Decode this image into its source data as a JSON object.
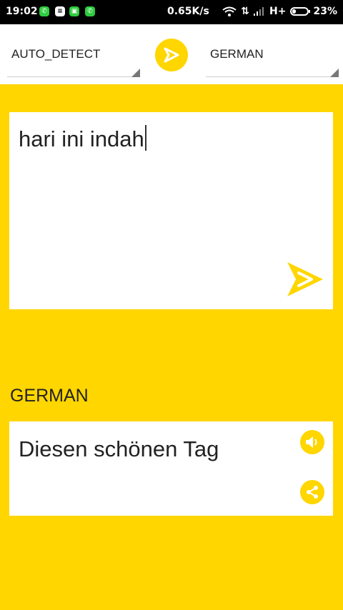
{
  "status_bar": {
    "time": "19:02",
    "net_speed": "0.65K/s",
    "network_type": "H+",
    "battery": "23%",
    "battery_level": 0.23,
    "notification_icons": [
      "whatsapp-icon",
      "message-icon",
      "chat-icon",
      "whatsapp-icon"
    ]
  },
  "language_bar": {
    "source_language": "AUTO_DETECT",
    "target_language": "GERMAN"
  },
  "input": {
    "text": "hari ini indah"
  },
  "output": {
    "language_label": "GERMAN",
    "text": "Diesen schönen Tag"
  },
  "colors": {
    "accent": "#FFD600",
    "card": "#FFFFFF",
    "status_bar": "#000000"
  }
}
